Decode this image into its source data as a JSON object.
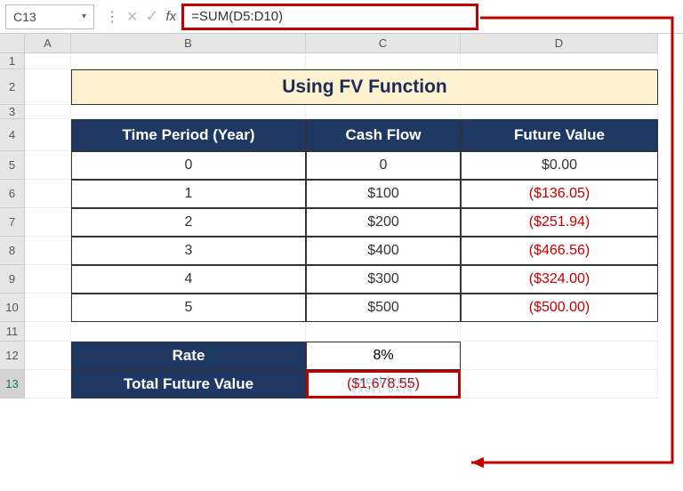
{
  "name_box": "C13",
  "formula": "=SUM(D5:D10)",
  "col_headers": [
    "",
    "A",
    "B",
    "C",
    "D"
  ],
  "row_headers": [
    "1",
    "2",
    "3",
    "4",
    "5",
    "6",
    "7",
    "8",
    "9",
    "10",
    "11",
    "12",
    "13"
  ],
  "title": "Using FV Function",
  "table": {
    "headers": [
      "Time Period (Year)",
      "Cash Flow",
      "Future Value"
    ],
    "rows": [
      {
        "period": "0",
        "cash": "0",
        "fv": "$0.00",
        "neg": false
      },
      {
        "period": "1",
        "cash": "$100",
        "fv": "($136.05)",
        "neg": true
      },
      {
        "period": "2",
        "cash": "$200",
        "fv": "($251.94)",
        "neg": true
      },
      {
        "period": "3",
        "cash": "$400",
        "fv": "($466.56)",
        "neg": true
      },
      {
        "period": "4",
        "cash": "$300",
        "fv": "($324.00)",
        "neg": true
      },
      {
        "period": "5",
        "cash": "$500",
        "fv": "($500.00)",
        "neg": true
      }
    ]
  },
  "rate_label": "Rate",
  "rate_value": "8%",
  "tfv_label": "Total Future Value",
  "tfv_value": "($1,678.55)",
  "watermark": "exceldemy",
  "watermark_sub": "EXCEL DATA",
  "chart_data": {
    "type": "table",
    "title": "Using FV Function",
    "columns": [
      "Time Period (Year)",
      "Cash Flow",
      "Future Value"
    ],
    "rows": [
      [
        0,
        0,
        0.0
      ],
      [
        1,
        100,
        -136.05
      ],
      [
        2,
        200,
        -251.94
      ],
      [
        3,
        400,
        -466.56
      ],
      [
        4,
        300,
        -324.0
      ],
      [
        5,
        500,
        -500.0
      ]
    ],
    "rate": 0.08,
    "total_future_value": -1678.55,
    "formula": "=SUM(D5:D10)"
  }
}
